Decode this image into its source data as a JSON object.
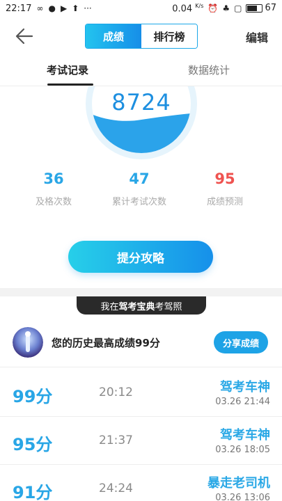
{
  "status_bar": {
    "time": "22:17",
    "net_speed": "0.04",
    "net_unit": "K/s",
    "battery": "67",
    "icons": [
      "infinity-icon",
      "chat-icon",
      "play-icon",
      "upload-icon",
      "more-dots-icon",
      "alarm-icon",
      "app-icon",
      "screen-icon",
      "battery-icon"
    ]
  },
  "header": {
    "tabs": [
      {
        "label": "成绩",
        "active": true
      },
      {
        "label": "排行榜",
        "active": false
      }
    ],
    "edit_label": "编辑"
  },
  "sub_tabs": [
    {
      "label": "考试记录",
      "active": true
    },
    {
      "label": "数据统计",
      "active": false
    }
  ],
  "gauge": {
    "value": "8724",
    "colors": {
      "ring": "#dff1fb",
      "wave": "#2ba3ea"
    }
  },
  "stats": [
    {
      "value": "36",
      "label": "及格次数",
      "color": "#29a6e6"
    },
    {
      "value": "47",
      "label": "累计考试次数",
      "color": "#29a6e6"
    },
    {
      "value": "95",
      "label": "成绩预测",
      "color": "#ef5350"
    }
  ],
  "cta_label": "提分攻略",
  "promo": {
    "prefix": "我在",
    "highlight": "驾考宝典",
    "suffix": "考驾照"
  },
  "best": {
    "text": "您的历史最高成绩99分",
    "share_label": "分享成绩"
  },
  "records": [
    {
      "score": "99分",
      "duration": "20:12",
      "title": "驾考车神",
      "date": "03.26  21:44"
    },
    {
      "score": "95分",
      "duration": "21:37",
      "title": "驾考车神",
      "date": "03.26  18:05"
    },
    {
      "score": "91分",
      "duration": "24:24",
      "title": "暴走老司机",
      "date": "03.26  13:06"
    }
  ]
}
